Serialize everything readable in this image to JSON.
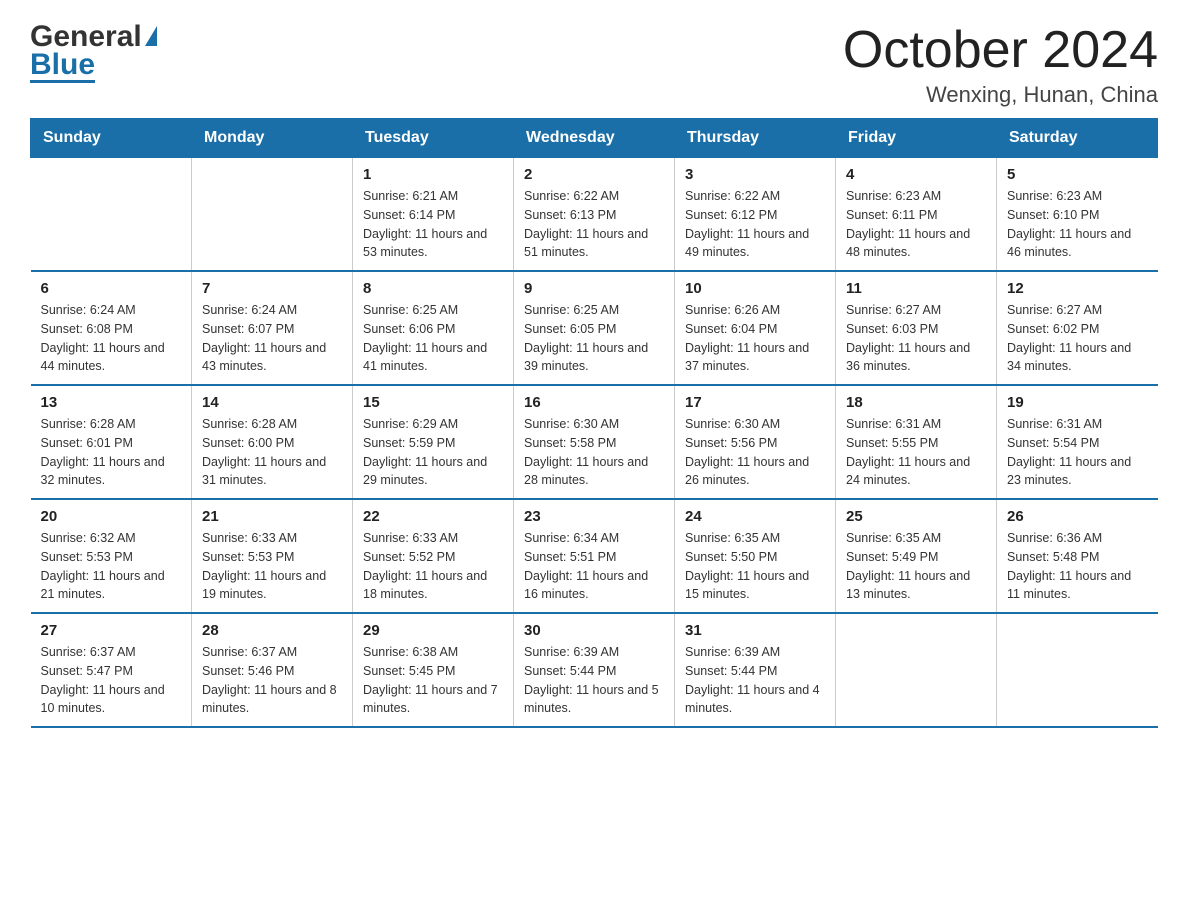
{
  "logo": {
    "general": "General",
    "triangle_char": "▶",
    "blue": "Blue"
  },
  "title": {
    "month_year": "October 2024",
    "location": "Wenxing, Hunan, China"
  },
  "days_of_week": [
    "Sunday",
    "Monday",
    "Tuesday",
    "Wednesday",
    "Thursday",
    "Friday",
    "Saturday"
  ],
  "weeks": [
    [
      {
        "day": "",
        "sunrise": "",
        "sunset": "",
        "daylight": ""
      },
      {
        "day": "",
        "sunrise": "",
        "sunset": "",
        "daylight": ""
      },
      {
        "day": "1",
        "sunrise": "Sunrise: 6:21 AM",
        "sunset": "Sunset: 6:14 PM",
        "daylight": "Daylight: 11 hours and 53 minutes."
      },
      {
        "day": "2",
        "sunrise": "Sunrise: 6:22 AM",
        "sunset": "Sunset: 6:13 PM",
        "daylight": "Daylight: 11 hours and 51 minutes."
      },
      {
        "day": "3",
        "sunrise": "Sunrise: 6:22 AM",
        "sunset": "Sunset: 6:12 PM",
        "daylight": "Daylight: 11 hours and 49 minutes."
      },
      {
        "day": "4",
        "sunrise": "Sunrise: 6:23 AM",
        "sunset": "Sunset: 6:11 PM",
        "daylight": "Daylight: 11 hours and 48 minutes."
      },
      {
        "day": "5",
        "sunrise": "Sunrise: 6:23 AM",
        "sunset": "Sunset: 6:10 PM",
        "daylight": "Daylight: 11 hours and 46 minutes."
      }
    ],
    [
      {
        "day": "6",
        "sunrise": "Sunrise: 6:24 AM",
        "sunset": "Sunset: 6:08 PM",
        "daylight": "Daylight: 11 hours and 44 minutes."
      },
      {
        "day": "7",
        "sunrise": "Sunrise: 6:24 AM",
        "sunset": "Sunset: 6:07 PM",
        "daylight": "Daylight: 11 hours and 43 minutes."
      },
      {
        "day": "8",
        "sunrise": "Sunrise: 6:25 AM",
        "sunset": "Sunset: 6:06 PM",
        "daylight": "Daylight: 11 hours and 41 minutes."
      },
      {
        "day": "9",
        "sunrise": "Sunrise: 6:25 AM",
        "sunset": "Sunset: 6:05 PM",
        "daylight": "Daylight: 11 hours and 39 minutes."
      },
      {
        "day": "10",
        "sunrise": "Sunrise: 6:26 AM",
        "sunset": "Sunset: 6:04 PM",
        "daylight": "Daylight: 11 hours and 37 minutes."
      },
      {
        "day": "11",
        "sunrise": "Sunrise: 6:27 AM",
        "sunset": "Sunset: 6:03 PM",
        "daylight": "Daylight: 11 hours and 36 minutes."
      },
      {
        "day": "12",
        "sunrise": "Sunrise: 6:27 AM",
        "sunset": "Sunset: 6:02 PM",
        "daylight": "Daylight: 11 hours and 34 minutes."
      }
    ],
    [
      {
        "day": "13",
        "sunrise": "Sunrise: 6:28 AM",
        "sunset": "Sunset: 6:01 PM",
        "daylight": "Daylight: 11 hours and 32 minutes."
      },
      {
        "day": "14",
        "sunrise": "Sunrise: 6:28 AM",
        "sunset": "Sunset: 6:00 PM",
        "daylight": "Daylight: 11 hours and 31 minutes."
      },
      {
        "day": "15",
        "sunrise": "Sunrise: 6:29 AM",
        "sunset": "Sunset: 5:59 PM",
        "daylight": "Daylight: 11 hours and 29 minutes."
      },
      {
        "day": "16",
        "sunrise": "Sunrise: 6:30 AM",
        "sunset": "Sunset: 5:58 PM",
        "daylight": "Daylight: 11 hours and 28 minutes."
      },
      {
        "day": "17",
        "sunrise": "Sunrise: 6:30 AM",
        "sunset": "Sunset: 5:56 PM",
        "daylight": "Daylight: 11 hours and 26 minutes."
      },
      {
        "day": "18",
        "sunrise": "Sunrise: 6:31 AM",
        "sunset": "Sunset: 5:55 PM",
        "daylight": "Daylight: 11 hours and 24 minutes."
      },
      {
        "day": "19",
        "sunrise": "Sunrise: 6:31 AM",
        "sunset": "Sunset: 5:54 PM",
        "daylight": "Daylight: 11 hours and 23 minutes."
      }
    ],
    [
      {
        "day": "20",
        "sunrise": "Sunrise: 6:32 AM",
        "sunset": "Sunset: 5:53 PM",
        "daylight": "Daylight: 11 hours and 21 minutes."
      },
      {
        "day": "21",
        "sunrise": "Sunrise: 6:33 AM",
        "sunset": "Sunset: 5:53 PM",
        "daylight": "Daylight: 11 hours and 19 minutes."
      },
      {
        "day": "22",
        "sunrise": "Sunrise: 6:33 AM",
        "sunset": "Sunset: 5:52 PM",
        "daylight": "Daylight: 11 hours and 18 minutes."
      },
      {
        "day": "23",
        "sunrise": "Sunrise: 6:34 AM",
        "sunset": "Sunset: 5:51 PM",
        "daylight": "Daylight: 11 hours and 16 minutes."
      },
      {
        "day": "24",
        "sunrise": "Sunrise: 6:35 AM",
        "sunset": "Sunset: 5:50 PM",
        "daylight": "Daylight: 11 hours and 15 minutes."
      },
      {
        "day": "25",
        "sunrise": "Sunrise: 6:35 AM",
        "sunset": "Sunset: 5:49 PM",
        "daylight": "Daylight: 11 hours and 13 minutes."
      },
      {
        "day": "26",
        "sunrise": "Sunrise: 6:36 AM",
        "sunset": "Sunset: 5:48 PM",
        "daylight": "Daylight: 11 hours and 11 minutes."
      }
    ],
    [
      {
        "day": "27",
        "sunrise": "Sunrise: 6:37 AM",
        "sunset": "Sunset: 5:47 PM",
        "daylight": "Daylight: 11 hours and 10 minutes."
      },
      {
        "day": "28",
        "sunrise": "Sunrise: 6:37 AM",
        "sunset": "Sunset: 5:46 PM",
        "daylight": "Daylight: 11 hours and 8 minutes."
      },
      {
        "day": "29",
        "sunrise": "Sunrise: 6:38 AM",
        "sunset": "Sunset: 5:45 PM",
        "daylight": "Daylight: 11 hours and 7 minutes."
      },
      {
        "day": "30",
        "sunrise": "Sunrise: 6:39 AM",
        "sunset": "Sunset: 5:44 PM",
        "daylight": "Daylight: 11 hours and 5 minutes."
      },
      {
        "day": "31",
        "sunrise": "Sunrise: 6:39 AM",
        "sunset": "Sunset: 5:44 PM",
        "daylight": "Daylight: 11 hours and 4 minutes."
      },
      {
        "day": "",
        "sunrise": "",
        "sunset": "",
        "daylight": ""
      },
      {
        "day": "",
        "sunrise": "",
        "sunset": "",
        "daylight": ""
      }
    ]
  ]
}
